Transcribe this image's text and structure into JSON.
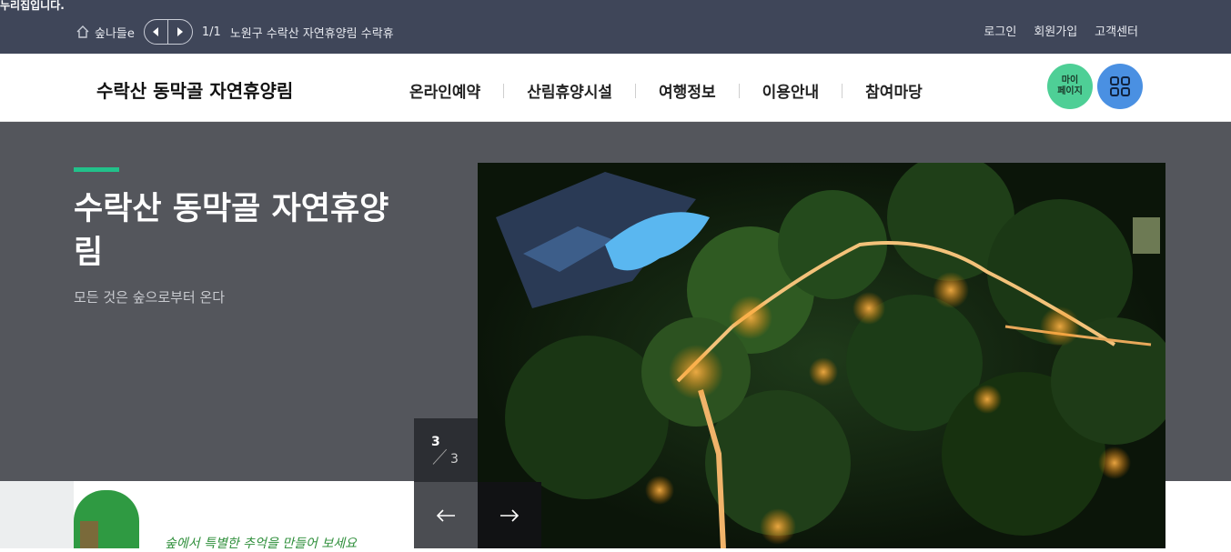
{
  "topbar": {
    "gov_notice": "누리집입니다.",
    "breadcrumb_site": "숲나들e",
    "breadcrumb_count": "1/1",
    "breadcrumb_path": "노원구 수락산 자연휴양림 수락휴",
    "util_links": [
      "로그인",
      "회원가입",
      "고객센터"
    ]
  },
  "header": {
    "logo": "수락산 동막골 자연휴양림",
    "nav": [
      "온라인예약",
      "산림휴양시설",
      "여행정보",
      "이용안내",
      "참여마당"
    ],
    "mypage_line1": "마이",
    "mypage_line2": "페이지"
  },
  "hero": {
    "title": "수락산 동막골 자연휴양림",
    "subtitle": "모든 것은 숲으로부터 온다",
    "slide_current": "3",
    "slide_total": "3"
  },
  "below": {
    "slogan": "숲에서 특별한 추억을 만들어 보세요"
  },
  "colors": {
    "topbar": "#3f4659",
    "hero_bg": "#54565c",
    "accent": "#22c18a",
    "mypage": "#4ecf96",
    "allmenu": "#4a90e2"
  },
  "icons": [
    "home-icon",
    "arrow-left-icon",
    "arrow-right-icon",
    "grid-menu-icon"
  ]
}
